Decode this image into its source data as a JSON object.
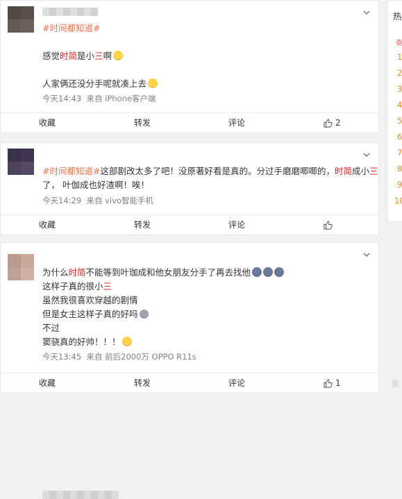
{
  "posts": [
    {
      "topic": "#时间都知道#",
      "lines": [
        {
          "parts": [
            {
              "t": "感觉"
            },
            {
              "t": "时简",
              "hl": true
            },
            {
              "t": "是小"
            },
            {
              "t": "三",
              "hl": true
            },
            {
              "t": "啊"
            }
          ],
          "emoji": "doge-icon"
        },
        {
          "parts": [
            {
              "t": "人家俩还没分手呢就凑上去"
            }
          ],
          "emoji": "facepalm-icon"
        }
      ],
      "time": "今天14:43",
      "source": "来自 iPhone客户端",
      "actions": {
        "fav": "收藏",
        "repost": "转发",
        "comment": "评论",
        "likes": "2"
      }
    },
    {
      "line1": [
        {
          "t": "#时间都知道#",
          "topic": true
        },
        {
          "t": "这部剧改太多了吧！没原著好看是真的。分过手磨磨唧唧的，"
        },
        {
          "t": "时简",
          "hl": true
        },
        {
          "t": "成小"
        },
        {
          "t": "三",
          "hl": true
        }
      ],
      "line2": "了， 叶伽成也好渣啊！唉！",
      "time": "今天14:29",
      "source": "来自 vivo智能手机",
      "actions": {
        "fav": "收藏",
        "repost": "转发",
        "comment": "评论",
        "likes": ""
      }
    },
    {
      "lines": [
        {
          "parts": [
            {
              "t": "为什么"
            },
            {
              "t": "时简",
              "hl": true
            },
            {
              "t": "不能等到叶珈成和他女朋友分手了再去找他"
            }
          ],
          "emoji_count": 3
        },
        {
          "parts": [
            {
              "t": "这样子真的很小"
            },
            {
              "t": "三",
              "hl": true
            }
          ]
        },
        {
          "parts": [
            {
              "t": "虽然我很喜欢穿越的剧情"
            }
          ]
        },
        {
          "parts": [
            {
              "t": "但是女主这样子真的好吗"
            }
          ],
          "emoji": "sad-icon"
        },
        {
          "parts": [
            {
              "t": "不过"
            }
          ]
        },
        {
          "parts": [
            {
              "t": "窦骁真的好帅！！！"
            }
          ],
          "emoji": "laugh-icon"
        }
      ],
      "time": "今天13:45",
      "source": "来自 前后2000万 OPPO R11s",
      "actions": {
        "fav": "收藏",
        "repost": "转发",
        "comment": "评论",
        "likes": "1"
      }
    }
  ],
  "sidebar": {
    "title": "热",
    "hot_mark": "查",
    "ranks": [
      "1",
      "2",
      "3",
      "4",
      "5",
      "6",
      "7",
      "8",
      "9",
      "10"
    ]
  },
  "watermark": "亲"
}
